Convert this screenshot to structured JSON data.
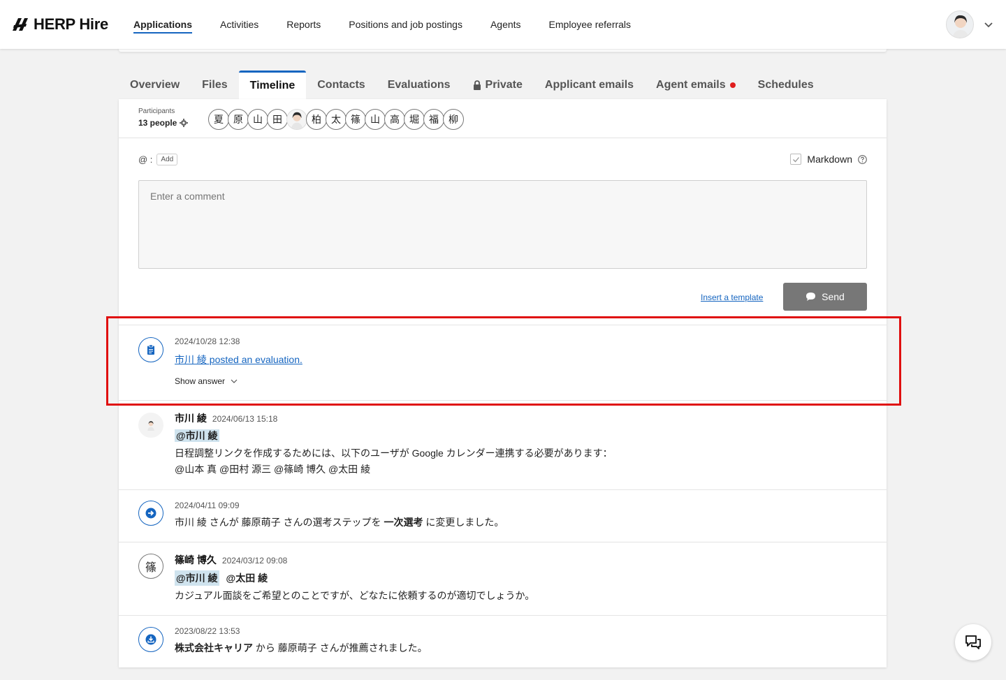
{
  "app": {
    "logo_text": "HERP Hire"
  },
  "nav": {
    "items": [
      {
        "label": "Applications",
        "active": true
      },
      {
        "label": "Activities"
      },
      {
        "label": "Reports"
      },
      {
        "label": "Positions and job postings"
      },
      {
        "label": "Agents"
      },
      {
        "label": "Employee referrals"
      }
    ]
  },
  "tabs": [
    {
      "label": "Overview"
    },
    {
      "label": "Files"
    },
    {
      "label": "Timeline",
      "active": true
    },
    {
      "label": "Contacts"
    },
    {
      "label": "Evaluations"
    },
    {
      "label": "Private",
      "icon": "lock-icon"
    },
    {
      "label": "Applicant emails"
    },
    {
      "label": "Agent emails",
      "badge": "red-dot"
    },
    {
      "label": "Schedules"
    }
  ],
  "participants": {
    "label": "Participants",
    "count": "13 people",
    "chips": [
      "夏",
      "原",
      "山",
      "田",
      "",
      "柏",
      "太",
      "篠",
      "山",
      "高",
      "堀",
      "福",
      "柳"
    ]
  },
  "composer": {
    "mention_prefix": "@ :",
    "add_label": "Add",
    "markdown_label": "Markdown",
    "placeholder": "Enter a comment",
    "insert_template": "Insert a template",
    "send_label": "Send"
  },
  "timeline": [
    {
      "type": "evaluation",
      "timestamp": "2024/10/28 12:38",
      "link_text": "市川 綾 posted an evaluation.",
      "show_answer": "Show answer"
    },
    {
      "type": "comment",
      "author": "市川 綾",
      "timestamp": "2024/06/13 15:18",
      "mention": "@市川 綾",
      "line1": "日程調整リンクを作成するためには、以下のユーザが Google カレンダー連携する必要があります：",
      "line2": "@山本 真 @田村 源三 @篠崎 博久 @太田 綾"
    },
    {
      "type": "step",
      "timestamp": "2024/04/11 09:09",
      "text_before": "市川 綾 さんが 藤原萌子 さんの選考ステップを ",
      "text_bold": "一次選考",
      "text_after": " に変更しました。"
    },
    {
      "type": "comment",
      "avatar_char": "篠",
      "author": "篠崎 博久",
      "timestamp": "2024/03/12 09:08",
      "mention1": "@市川 綾",
      "mention2": "@太田 綾",
      "line1": "カジュアル面談をご希望とのことですが、どなたに依頼するのが適切でしょうか。"
    },
    {
      "type": "referral",
      "timestamp": "2023/08/22 13:53",
      "text_bold": "株式会社キャリア",
      "text_after": " から 藤原萌子 さんが推薦されました。"
    }
  ],
  "colors": {
    "accent": "#1565c0",
    "highlight": "#e01010",
    "send_bg": "#777777",
    "mention_bg": "#cfe3ee"
  }
}
